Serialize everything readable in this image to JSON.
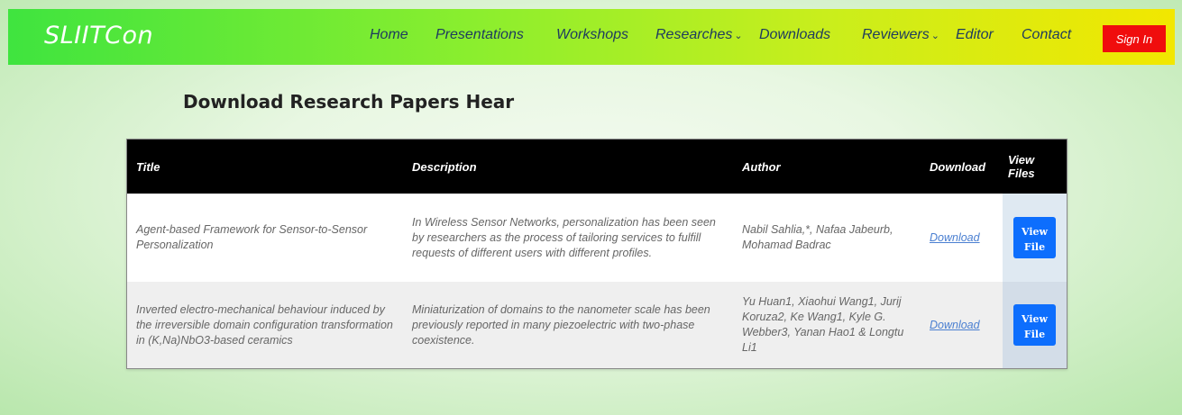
{
  "navbar": {
    "brand": "SLIITCon",
    "items": [
      {
        "label": "Home",
        "dropdown": false
      },
      {
        "label": "Presentations",
        "dropdown": false
      },
      {
        "label": "Workshops",
        "dropdown": false
      },
      {
        "label": "Researches",
        "dropdown": true
      },
      {
        "label": "Downloads",
        "dropdown": false
      },
      {
        "label": "Reviewers",
        "dropdown": true
      },
      {
        "label": "Editor",
        "dropdown": false
      },
      {
        "label": "Contact",
        "dropdown": false
      }
    ],
    "signin_label": "Sign In",
    "colors": {
      "gradient_start": "#3fe43f",
      "gradient_end": "#f2e700",
      "signin_bg": "#f00d0d",
      "nav_text": "#1e3a5f"
    }
  },
  "main": {
    "title": "Download Research Papers Hear",
    "table": {
      "headers": [
        "Title",
        "Description",
        "Author",
        "Download",
        "View Files"
      ],
      "rows": [
        {
          "title": "Agent-based Framework for Sensor-to-Sensor Personalization",
          "description": "In Wireless Sensor Networks, personalization has been seen by researchers as the process of tailoring services to fulfill requests of different users with different profiles.",
          "author": "Nabil Sahlia,*, Nafaa Jabeurb, Mohamad Badrac",
          "download_label": "Download",
          "view_label": "View File"
        },
        {
          "title": "Inverted electro-mechanical behaviour induced by the irreversible domain configuration transformation in (K,Na)NbO3-based ceramics",
          "description": "Miniaturization of domains to the nanometer scale has been previously reported in many piezoelectric with two-phase coexistence.",
          "author": "Yu Huan1, Xiaohui Wang1, Jurij Koruza2, Ke Wang1, Kyle G. Webber3, Yanan Hao1 & Longtu Li1",
          "download_label": "Download",
          "view_label": "View File"
        }
      ]
    },
    "colors": {
      "header_bg": "#000000",
      "button_bg": "#0d6efd",
      "link": "#4a7fd1"
    }
  }
}
